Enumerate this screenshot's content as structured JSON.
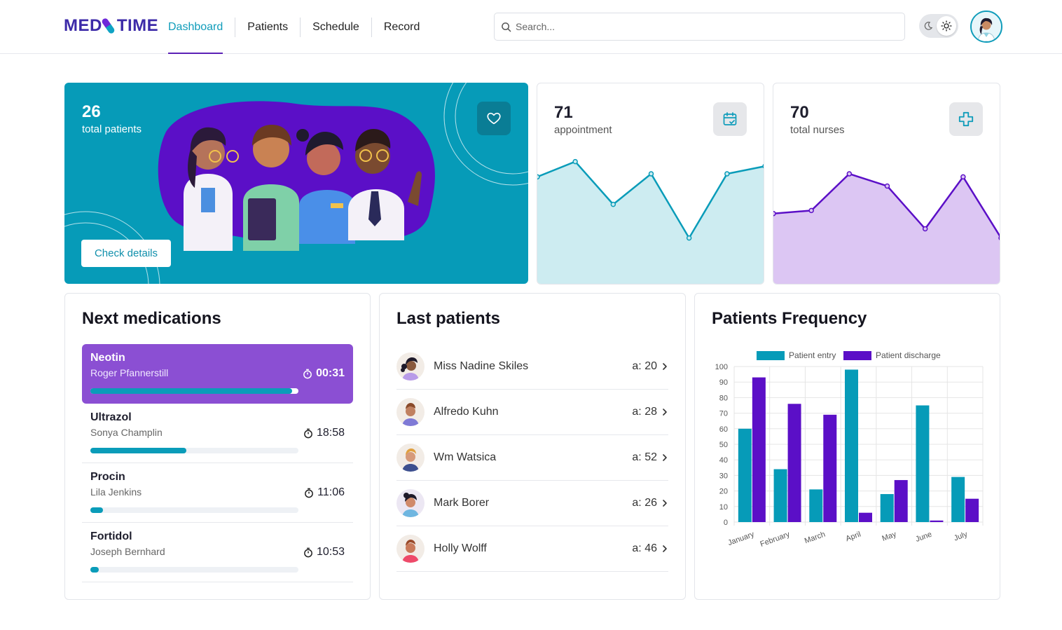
{
  "app": {
    "logo_left": "MED",
    "logo_right": "TIME",
    "brand_colors": {
      "teal": "#069bb8",
      "purple": "#5b21b6",
      "lilac": "#8b4fd3"
    }
  },
  "nav": {
    "tabs": [
      {
        "label": "Dashboard",
        "active": true
      },
      {
        "label": "Patients",
        "active": false
      },
      {
        "label": "Schedule",
        "active": false
      },
      {
        "label": "Record",
        "active": false
      }
    ]
  },
  "search": {
    "placeholder": "Search...",
    "value": ""
  },
  "theme_toggle": {
    "icons": [
      "moon-icon",
      "sun-icon"
    ],
    "selected": "light"
  },
  "hero": {
    "count": "26",
    "label": "total patients",
    "button": "Check details",
    "icon": "heart-icon"
  },
  "appointments": {
    "count": "71",
    "label": "appointment",
    "icon": "calendar-check-icon",
    "trend": [
      70,
      80,
      52,
      72,
      30,
      72,
      77
    ]
  },
  "nurses": {
    "count": "70",
    "label": "total nurses",
    "icon": "plus-icon",
    "trend": [
      46,
      48,
      72,
      64,
      36,
      70,
      30
    ]
  },
  "medications": {
    "title": "Next medications",
    "items": [
      {
        "name": "Neotin",
        "patient": "Roger Pfannerstill",
        "time": "00:31",
        "progress": 0.97,
        "active": true
      },
      {
        "name": "Ultrazol",
        "patient": "Sonya Champlin",
        "time": "18:58",
        "progress": 0.46,
        "active": false
      },
      {
        "name": "Procin",
        "patient": "Lila Jenkins",
        "time": "11:06",
        "progress": 0.06,
        "active": false
      },
      {
        "name": "Fortidol",
        "patient": "Joseph Bernhard",
        "time": "10:53",
        "progress": 0.04,
        "active": false
      }
    ]
  },
  "last_patients": {
    "title": "Last patients",
    "items": [
      {
        "name": "Miss Nadine Skiles",
        "age": "a: 20"
      },
      {
        "name": "Alfredo Kuhn",
        "age": "a: 28"
      },
      {
        "name": "Wm Watsica",
        "age": "a: 52"
      },
      {
        "name": "Mark Borer",
        "age": "a: 26"
      },
      {
        "name": "Holly Wolff",
        "age": "a: 46"
      }
    ]
  },
  "frequency": {
    "title": "Patients Frequency"
  },
  "chart_data": {
    "type": "bar",
    "title": "Patients Frequency",
    "categories": [
      "January",
      "February",
      "March",
      "April",
      "May",
      "June",
      "July"
    ],
    "series": [
      {
        "name": "Patient entry",
        "color": "#069bb8",
        "values": [
          60,
          34,
          21,
          98,
          18,
          75,
          29
        ]
      },
      {
        "name": "Patient discharge",
        "color": "#5b0fc7",
        "values": [
          93,
          76,
          69,
          6,
          27,
          1,
          15
        ]
      }
    ],
    "ylim": [
      0,
      100
    ],
    "yticks": [
      "0",
      "10",
      "20",
      "30",
      "40",
      "50",
      "60",
      "70",
      "80",
      "90",
      "100"
    ],
    "grid": true,
    "legend": "top"
  }
}
